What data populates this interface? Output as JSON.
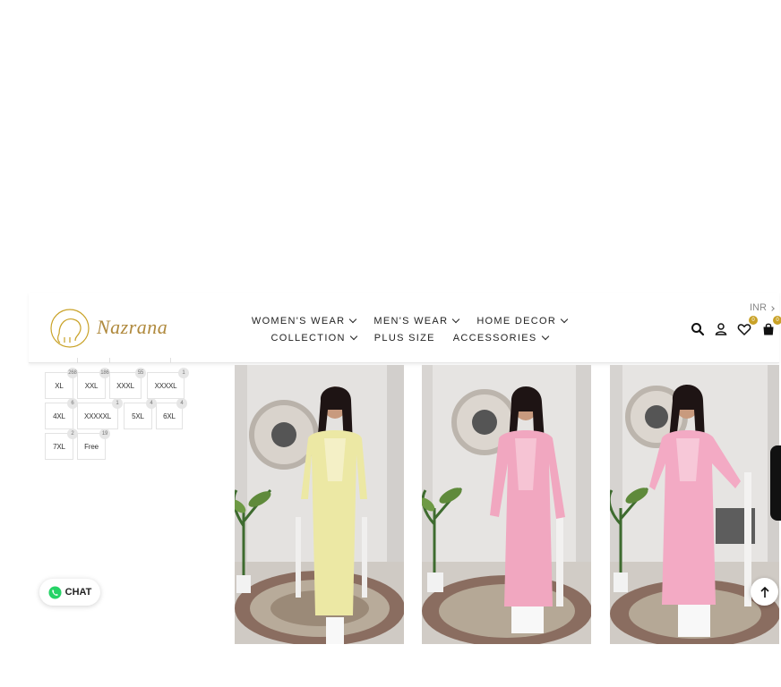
{
  "header": {
    "logo_text": "Nazrana",
    "currency": "INR",
    "nav_row1": [
      "WOMEN'S WEAR",
      "MEN'S WEAR",
      "HOME DECOR"
    ],
    "nav_row2": [
      "COLLECTION",
      "PLUS SIZE",
      "ACCESSORIES"
    ],
    "wishlist_count": "0",
    "cart_count": "0"
  },
  "sizes": [
    {
      "label": "XL",
      "count": "268"
    },
    {
      "label": "XXL",
      "count": "186"
    },
    {
      "label": "XXXL",
      "count": "55"
    },
    {
      "label": "XXXXL",
      "count": "1"
    },
    {
      "label": "4XL",
      "count": "6"
    },
    {
      "label": "XXXXXL",
      "count": "1"
    },
    {
      "label": "5XL",
      "count": "4"
    },
    {
      "label": "6XL",
      "count": "4"
    },
    {
      "label": "7XL",
      "count": "2"
    },
    {
      "label": "Free",
      "count": "19"
    }
  ],
  "products": [
    {
      "color": "yellow-kurta"
    },
    {
      "color": "pink-kurta"
    },
    {
      "color": "pink-kurta-long"
    }
  ],
  "chat": {
    "label": "CHAT"
  },
  "colors": {
    "accent": "#c9a227",
    "logo": "#b08a3e",
    "whatsapp": "#25d366"
  }
}
